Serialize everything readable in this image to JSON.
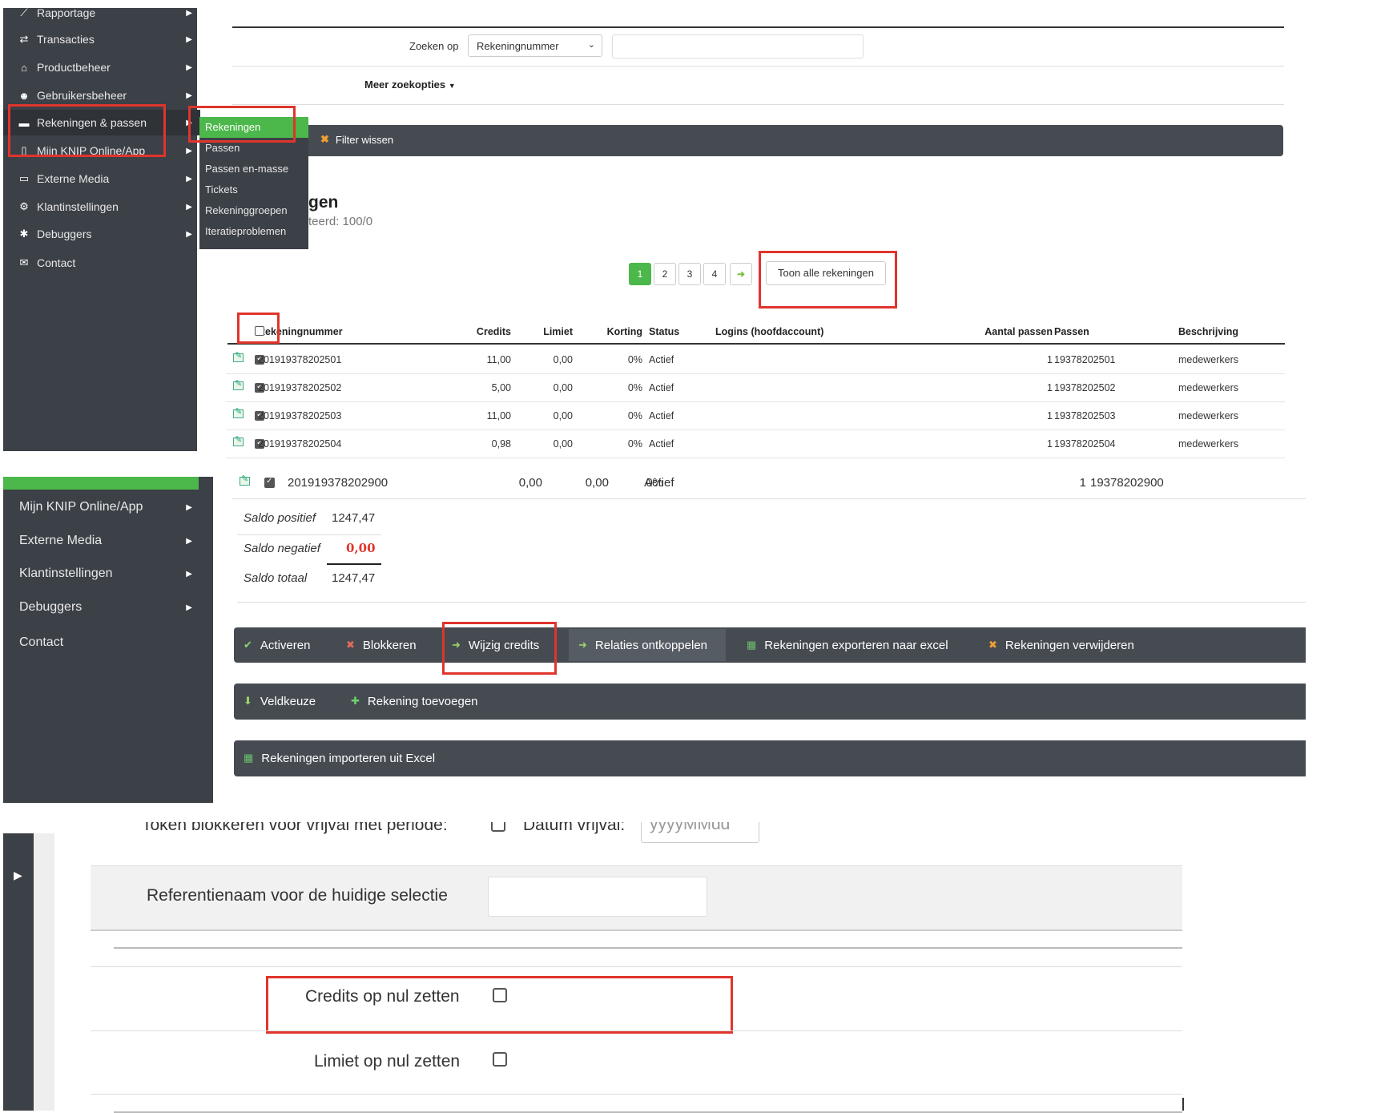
{
  "panel1": {
    "sidebar": {
      "items": [
        {
          "label": "Rapportage",
          "icon": "chart-icon"
        },
        {
          "label": "Transacties",
          "icon": "exchange-icon"
        },
        {
          "label": "Productbeheer",
          "icon": "basket-icon"
        },
        {
          "label": "Gebruikersbeheer",
          "icon": "users-icon"
        },
        {
          "label": "Rekeningen & passen",
          "icon": "card-icon"
        },
        {
          "label": "Mijn KNIP Online/App",
          "icon": "phone-icon"
        },
        {
          "label": "Externe Media",
          "icon": "monitor-icon"
        },
        {
          "label": "Klantinstellingen",
          "icon": "cogs-icon"
        },
        {
          "label": "Debuggers",
          "icon": "bug-icon"
        },
        {
          "label": "Contact",
          "icon": "envelope-icon"
        }
      ]
    },
    "submenu": [
      "Rekeningen",
      "Passen",
      "Passen en-masse",
      "Tickets",
      "Rekeninggroepen",
      "Iteratieproblemen"
    ],
    "search": {
      "label": "Zoeken op",
      "select_value": "Rekeningnummer",
      "input_value": ""
    },
    "more_options": "Meer zoekopties",
    "filter_clear": "Filter wissen",
    "heading_partial": "gen",
    "subheading_partial": "teerd: 100/0",
    "pagination": {
      "pages": [
        "1",
        "2",
        "3",
        "4"
      ],
      "show_all": "Toon alle rekeningen"
    },
    "table": {
      "headers": [
        "Rekeningnummer",
        "Credits",
        "Limiet",
        "Korting",
        "Status",
        "Logins (hoofdaccount)",
        "Aantal passen",
        "Passen",
        "Beschrijving"
      ],
      "rows": [
        [
          "201919378202501",
          "11,00",
          "0,00",
          "0%",
          "Actief",
          "",
          "1",
          "19378202501",
          "medewerkers"
        ],
        [
          "201919378202502",
          "5,00",
          "0,00",
          "0%",
          "Actief",
          "",
          "1",
          "19378202502",
          "medewerkers"
        ],
        [
          "201919378202503",
          "11,00",
          "0,00",
          "0%",
          "Actief",
          "",
          "1",
          "19378202503",
          "medewerkers"
        ],
        [
          "201919378202504",
          "0,98",
          "0,00",
          "0%",
          "Actief",
          "",
          "1",
          "19378202504",
          "medewerkers"
        ]
      ]
    }
  },
  "panel2": {
    "sidebar": {
      "items": [
        {
          "label": "Mijn KNIP Online/App"
        },
        {
          "label": "Externe Media"
        },
        {
          "label": "Klantinstellingen"
        },
        {
          "label": "Debuggers"
        },
        {
          "label": "Contact"
        }
      ]
    },
    "row": [
      "201919378202900",
      "0,00",
      "0,00",
      "0%",
      "Actief",
      "1",
      "19378202900"
    ],
    "saldo": {
      "positief_label": "Saldo positief",
      "positief_value": "1247,47",
      "negatief_label": "Saldo negatief",
      "negatief_value": "0,00",
      "totaal_label": "Saldo totaal",
      "totaal_value": "1247,47"
    },
    "actions1": [
      {
        "label": "Activeren",
        "icon": "check-icon"
      },
      {
        "label": "Blokkeren",
        "icon": "block-icon"
      },
      {
        "label": "Wijzig credits",
        "icon": "arrow-icon"
      },
      {
        "label": "Relaties ontkoppelen",
        "icon": "arrow-icon"
      },
      {
        "label": "Rekeningen exporteren naar excel",
        "icon": "excel-icon"
      },
      {
        "label": "Rekeningen verwijderen",
        "icon": "delete-icon"
      }
    ],
    "actions2": [
      {
        "label": "Veldkeuze",
        "icon": "down-arrow-icon"
      },
      {
        "label": "Rekening toevoegen",
        "icon": "plus-icon"
      }
    ],
    "actions3": [
      {
        "label": "Rekeningen importeren uit Excel",
        "icon": "excel-icon"
      }
    ]
  },
  "panel3": {
    "top_partial_label": "Token blokkeren voor vrijval met periode:",
    "top_partial_date_label": "Datum vrijval:",
    "top_partial_date_placeholder": "yyyyMMdd",
    "reference_label": "Referentienaam voor de huidige selectie",
    "credits_zero_label": "Credits op nul zetten",
    "limit_zero_label": "Limiet op nul zetten"
  },
  "colors": {
    "sidebar": "#3c4047",
    "accent_green": "#4cb74a",
    "highlight_red": "#e0342c",
    "bar": "#464b52"
  }
}
